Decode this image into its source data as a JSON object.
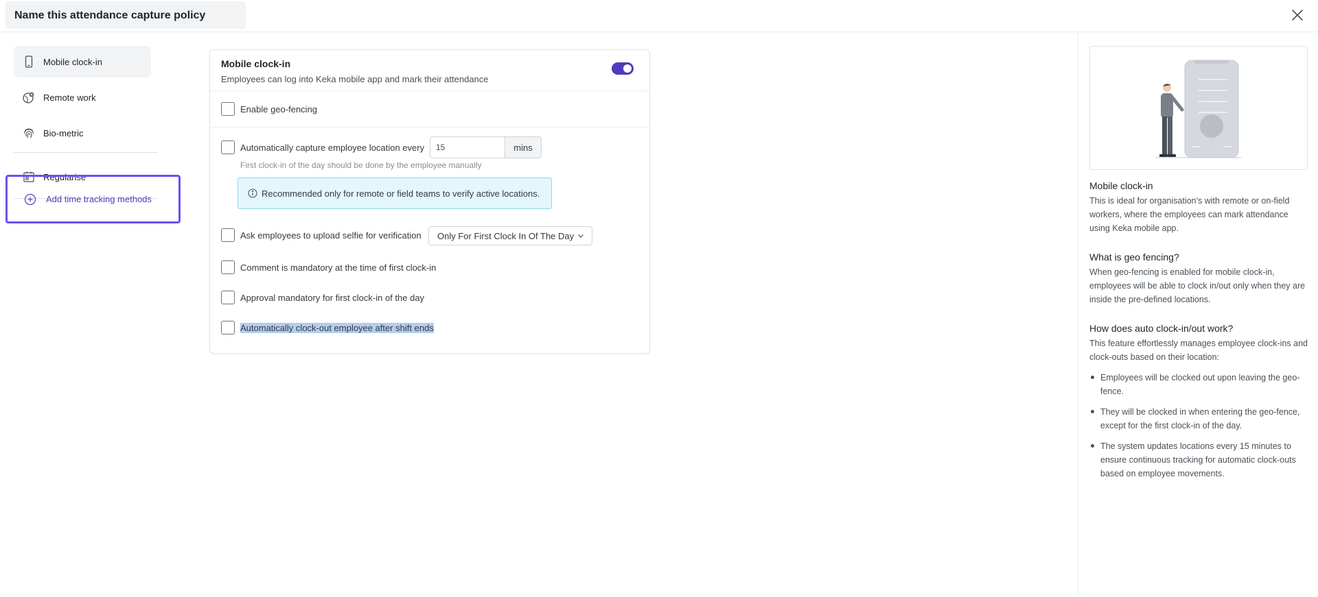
{
  "header": {
    "title": "Name this attendance capture policy"
  },
  "leftnav": {
    "items": [
      {
        "label": "Mobile clock-in",
        "icon": "mobile-phone-icon",
        "active": true
      },
      {
        "label": "Remote work",
        "icon": "globe-location-icon"
      },
      {
        "label": "Bio-metric",
        "icon": "fingerprint-icon"
      },
      {
        "label": "Regularise",
        "icon": "calendar-icon"
      }
    ],
    "add_methods_label": "Add time tracking methods"
  },
  "card": {
    "title": "Mobile clock-in",
    "subtitle": "Employees can log into Keka mobile app and mark their attendance",
    "toggle_on": true,
    "geo_fencing_label": "Enable geo-fencing",
    "auto_capture": {
      "label": "Automatically capture employee location every",
      "value": "15",
      "unit": "mins",
      "help": "First clock-in of the day should be done by the employee manually"
    },
    "info_text": "Recommended only for remote or field teams to verify active locations.",
    "selfie": {
      "label": "Ask employees to upload selfie for verification",
      "selected": "Only For First Clock In Of The Day"
    },
    "comment_label": "Comment is mandatory at the time of first clock-in",
    "approval_label": "Approval mandatory for first clock-in of the day",
    "auto_clockout_label": "Automatically clock-out employee after shift ends"
  },
  "rightpane": {
    "section1": {
      "heading": "Mobile clock-in",
      "body": "This is ideal for organisation's with remote or on-field workers, where the employees can mark attendance using Keka mobile app."
    },
    "section2": {
      "heading": "What is geo fencing?",
      "body": "When geo-fencing is enabled for mobile clock-in, employees will be able to clock in/out only when they are inside the pre-defined locations."
    },
    "section3": {
      "heading": "How does auto clock-in/out work?",
      "body": "This feature effortlessly manages employee clock-ins and clock-outs based on their location:",
      "bullets": [
        "Employees will be clocked out upon leaving the geo-fence.",
        "They will be clocked in when entering the geo-fence, except for the first clock-in of the day.",
        "The system updates locations every 15 minutes to ensure continuous tracking for automatic clock-outs based on employee movements."
      ]
    }
  },
  "colors": {
    "accent": "#4e3bbf",
    "highlight_border": "#6a4ff5",
    "info_bg": "#e3f7fc",
    "selection": "#b4cdf0"
  }
}
